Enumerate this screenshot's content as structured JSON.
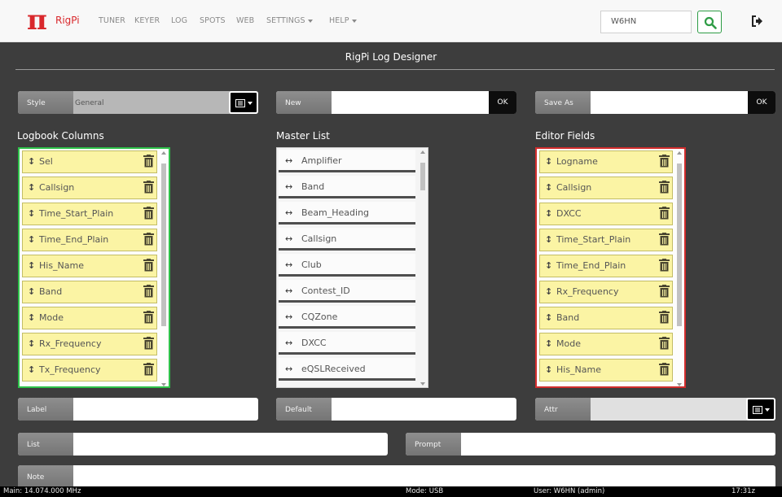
{
  "navbar": {
    "logo": "π",
    "brand": "RigPi",
    "links": [
      "TUNER",
      "KEYER",
      "LOG",
      "SPOTS",
      "WEB"
    ],
    "dropdowns": [
      "SETTINGS",
      "HELP"
    ],
    "callsign_value": "W6HN",
    "icons": {
      "search": "search-icon",
      "logout": "sign-out-icon"
    }
  },
  "title": "RigPi Log Designer",
  "style_group": {
    "label": "Style",
    "value": "General"
  },
  "new_group": {
    "label": "New",
    "ok": "OK"
  },
  "saveas_group": {
    "label": "Save As",
    "ok": "OK"
  },
  "sections": {
    "logbook": "Logbook Columns",
    "master": "Master List",
    "editor": "Editor Fields"
  },
  "logbook_columns": [
    "Sel",
    "Callsign",
    "Time_Start_Plain",
    "Time_End_Plain",
    "His_Name",
    "Band",
    "Mode",
    "Rx_Frequency",
    "Tx_Frequency"
  ],
  "master_list": [
    "Amplifier",
    "Band",
    "Beam_Heading",
    "Callsign",
    "Club",
    "Contest_ID",
    "CQZone",
    "DXCC",
    "eQSLReceived"
  ],
  "editor_fields": [
    "Logname",
    "Callsign",
    "DXCC",
    "Time_Start_Plain",
    "Time_End_Plain",
    "Rx_Frequency",
    "Band",
    "Mode",
    "His_Name"
  ],
  "fields": {
    "label": "Label",
    "default": "Default",
    "attr": "Attr",
    "list": "List",
    "prompt": "Prompt",
    "note": "Note"
  },
  "status": {
    "main": "Main: 14.074.000 MHz",
    "mode": "Mode: USB",
    "user": "User: W6HN (admin)",
    "time": "17:31z"
  },
  "colors": {
    "brand": "#d9282c",
    "accent_green": "#2ec14a",
    "accent_red": "#d22d2d",
    "item_yellow": "#fbf4a4",
    "background": "#3d3d3d"
  }
}
